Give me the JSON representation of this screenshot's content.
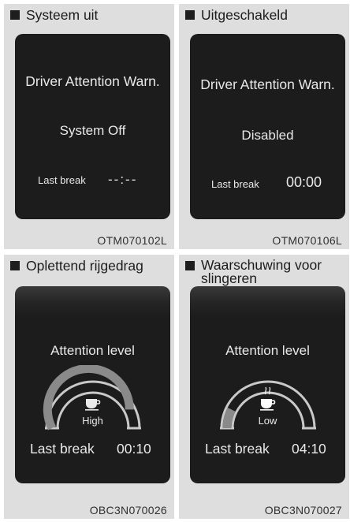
{
  "panels": [
    {
      "caption": "Systeem uit",
      "title": "Driver Attention Warn.",
      "status": "System Off",
      "last_break_label": "Last break",
      "last_break_time": "--:--",
      "code": "OTM070102L"
    },
    {
      "caption": "Uitgeschakeld",
      "title": "Driver Attention Warn.",
      "status": "Disabled",
      "last_break_label": "Last break",
      "last_break_time": "00:00",
      "code": "OTM070106L"
    },
    {
      "caption": "Oplettend rijgedrag",
      "title": "Attention level",
      "level": "High",
      "level_fraction": 0.85,
      "last_break_label": "Last break",
      "last_break_time": "00:10",
      "code": "OBC3N070026"
    },
    {
      "caption": "Waarschuwing voor slingeren",
      "title": "Attention level",
      "level": "Low",
      "level_fraction": 0.15,
      "last_break_label": "Last break",
      "last_break_time": "04:10",
      "code": "OBC3N070027"
    }
  ],
  "icons": {
    "coffee": "coffee-cup-icon",
    "steam": "steam-icon",
    "bullet": "square-bullet-icon"
  },
  "colors": {
    "screen": "#1c1c1c",
    "panel_bg": "#dedede",
    "text": "#e9e9e9"
  }
}
